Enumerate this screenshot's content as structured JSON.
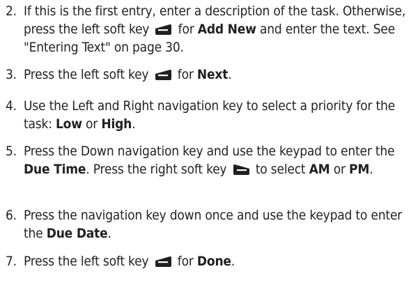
{
  "steps": [
    {
      "number": "2.",
      "p1": "If this is the first entry, enter a description of the task. Otherwise, press the left soft key",
      "b1": "Add New",
      "p2": "and enter the text. See \"Entering Text\" on page 30.",
      "icon1": "left-soft-key-icon",
      "connector1": "for"
    },
    {
      "number": "3.",
      "p1": "Press the left soft key",
      "connector1": "for",
      "b1": "Next",
      "end": ".",
      "icon1": "left-soft-key-icon"
    },
    {
      "number": "4.",
      "p1": "Use the Left and Right navigation key to select a priority for the task:",
      "b1": "Low",
      "connector1": "or",
      "b2": "High",
      "end": "."
    },
    {
      "number": "5.",
      "p1": "Press the Down navigation key and use the keypad to enter the",
      "b1": "Due Time",
      "p2": ". Press the right soft key",
      "icon1": "right-soft-key-icon",
      "p3": "to select",
      "b2": "AM",
      "connector1": "or",
      "b3": "PM",
      "end": "."
    },
    {
      "number": "6.",
      "p1": "Press the navigation key down once and use the keypad to enter the",
      "b1": "Due Date",
      "end": "."
    },
    {
      "number": "7.",
      "p1": "Press the left soft key",
      "connector1": "for",
      "b1": "Done",
      "end": ".",
      "icon1": "left-soft-key-icon"
    }
  ],
  "colors": {
    "text": "#231f20",
    "key": "#231f20"
  }
}
